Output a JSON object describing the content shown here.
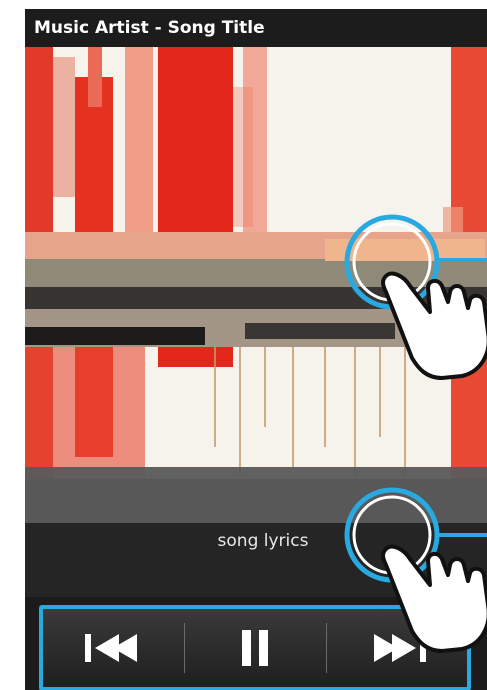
{
  "header": {
    "title": "Music Artist - Song Title"
  },
  "player": {
    "lyrics_text": "song lyrics"
  },
  "controls": {
    "previous_icon": "skip-previous-icon",
    "pause_icon": "pause-icon",
    "next_icon": "skip-next-icon"
  },
  "colors": {
    "highlight": "#29a9e1",
    "title_bar": "#1c1c1c",
    "art_red": "#e5311f"
  }
}
